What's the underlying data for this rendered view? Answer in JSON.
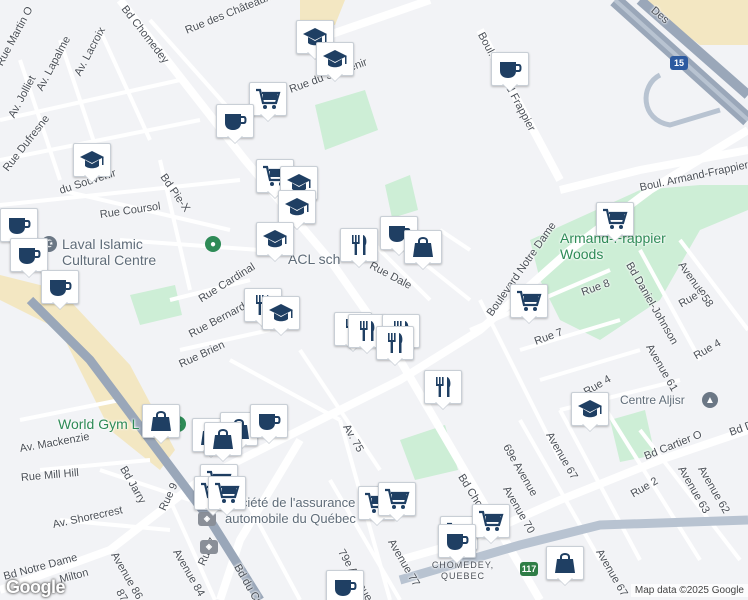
{
  "street_labels": [
    "Rue des Châteaux",
    "Av. Lacroix",
    "Av. Lapalme",
    "Av. Jolliet",
    "Rue Dufresne",
    "Rue Coursol",
    "Bd Pie-X",
    "Rue Cardinal",
    "Rue Bernard",
    "Rue Brien",
    "Bd Chomedey",
    "Rue Dale",
    "Boulevard Notre Dame",
    "Boul. Armand-Frappier",
    "Rue 8",
    "Rue 7",
    "Bd Daniel-Johnson",
    "Avenue 58",
    "Rue 5",
    "Rue 4",
    "Avenue 61",
    "Avenue 67",
    "69e Avenue",
    "Avenue 70",
    "Bd Cartier O",
    "Avenue 62",
    "Avenue 63",
    "Rue 2",
    "Av. 75",
    "Av. Mackenzie",
    "Bd Jarry",
    "Rue Mill Hill",
    "Av. Shorecrest",
    "Rue 9",
    "Rue 7",
    "Avenue 84",
    "Avenue 86",
    "Bd du Curé",
    "79e Avenue",
    "Avenue 77",
    "Rue 4",
    "Boul. Armand Frappier",
    "Des",
    "Bd Chomedey",
    "Bd Notre Dame",
    "du Souvenir",
    "Rue du Souvenir",
    "Rue Martin O",
    "Milton",
    "Avenue 67",
    "Bd Da",
    "87e A"
  ],
  "poi_labels": {
    "islamic_centre": "Laval Islamic Cultural Centre",
    "acl": "ACL sch",
    "armand_woods": "Armand-Frappier Woods",
    "world_gym": "World Gym L",
    "centre_aljisr": "Centre Aljisr",
    "saaq": "Société de l'assurance automobile du Québec",
    "chomedey": "CHOMEDEY, QUEBEC"
  },
  "shields": [
    "15",
    "117"
  ],
  "markers": [
    {
      "type": "school",
      "icon": "graduation-cap-icon"
    },
    {
      "type": "school",
      "icon": "graduation-cap-icon"
    },
    {
      "type": "cafe",
      "icon": "coffee-cup-icon"
    },
    {
      "type": "grocery",
      "icon": "shopping-cart-icon"
    },
    {
      "type": "cafe",
      "icon": "coffee-cup-icon"
    },
    {
      "type": "school",
      "icon": "graduation-cap-icon"
    },
    {
      "type": "grocery",
      "icon": "shopping-cart-icon"
    },
    {
      "type": "school",
      "icon": "graduation-cap-icon"
    },
    {
      "type": "school",
      "icon": "graduation-cap-icon"
    },
    {
      "type": "cafe",
      "icon": "coffee-cup-icon"
    },
    {
      "type": "school",
      "icon": "graduation-cap-icon"
    },
    {
      "type": "restaurant",
      "icon": "fork-knife-icon"
    },
    {
      "type": "cafe",
      "icon": "coffee-cup-icon"
    },
    {
      "type": "shopping",
      "icon": "shopping-bag-icon"
    },
    {
      "type": "grocery",
      "icon": "shopping-cart-icon"
    },
    {
      "type": "cafe",
      "icon": "coffee-cup-icon"
    },
    {
      "type": "cafe",
      "icon": "coffee-cup-icon"
    },
    {
      "type": "restaurant",
      "icon": "fork-knife-icon"
    },
    {
      "type": "school",
      "icon": "graduation-cap-icon"
    },
    {
      "type": "grocery",
      "icon": "shopping-cart-icon"
    },
    {
      "type": "restaurant",
      "icon": "fork-knife-icon"
    },
    {
      "type": "restaurant",
      "icon": "fork-knife-icon"
    },
    {
      "type": "restaurant",
      "icon": "fork-knife-icon"
    },
    {
      "type": "restaurant",
      "icon": "fork-knife-icon"
    },
    {
      "type": "restaurant",
      "icon": "fork-knife-icon"
    },
    {
      "type": "school",
      "icon": "graduation-cap-icon"
    },
    {
      "type": "shopping",
      "icon": "shopping-bag-icon"
    },
    {
      "type": "shopping",
      "icon": "shopping-bag-icon"
    },
    {
      "type": "shopping",
      "icon": "shopping-bag-icon"
    },
    {
      "type": "cafe",
      "icon": "coffee-cup-icon"
    },
    {
      "type": "shopping",
      "icon": "shopping-bag-icon"
    },
    {
      "type": "grocery",
      "icon": "shopping-cart-icon"
    },
    {
      "type": "grocery",
      "icon": "shopping-cart-icon"
    },
    {
      "type": "grocery",
      "icon": "shopping-cart-icon"
    },
    {
      "type": "grocery",
      "icon": "shopping-cart-icon"
    },
    {
      "type": "grocery",
      "icon": "shopping-cart-icon"
    },
    {
      "type": "grocery",
      "icon": "shopping-cart-icon"
    },
    {
      "type": "grocery",
      "icon": "shopping-cart-icon"
    },
    {
      "type": "cafe",
      "icon": "coffee-cup-icon"
    },
    {
      "type": "cafe",
      "icon": "coffee-cup-icon"
    },
    {
      "type": "shopping",
      "icon": "shopping-bag-icon"
    }
  ],
  "brand": "Google",
  "attribution": "Map data ©2025 Google",
  "colors": {
    "marker_icon": "#1f3f63",
    "highway": "#9aa7b9",
    "park": "#cdeed6",
    "commercial": "#f3e7c2",
    "road": "#ffffff",
    "water_hint": "#d6e4f0"
  }
}
